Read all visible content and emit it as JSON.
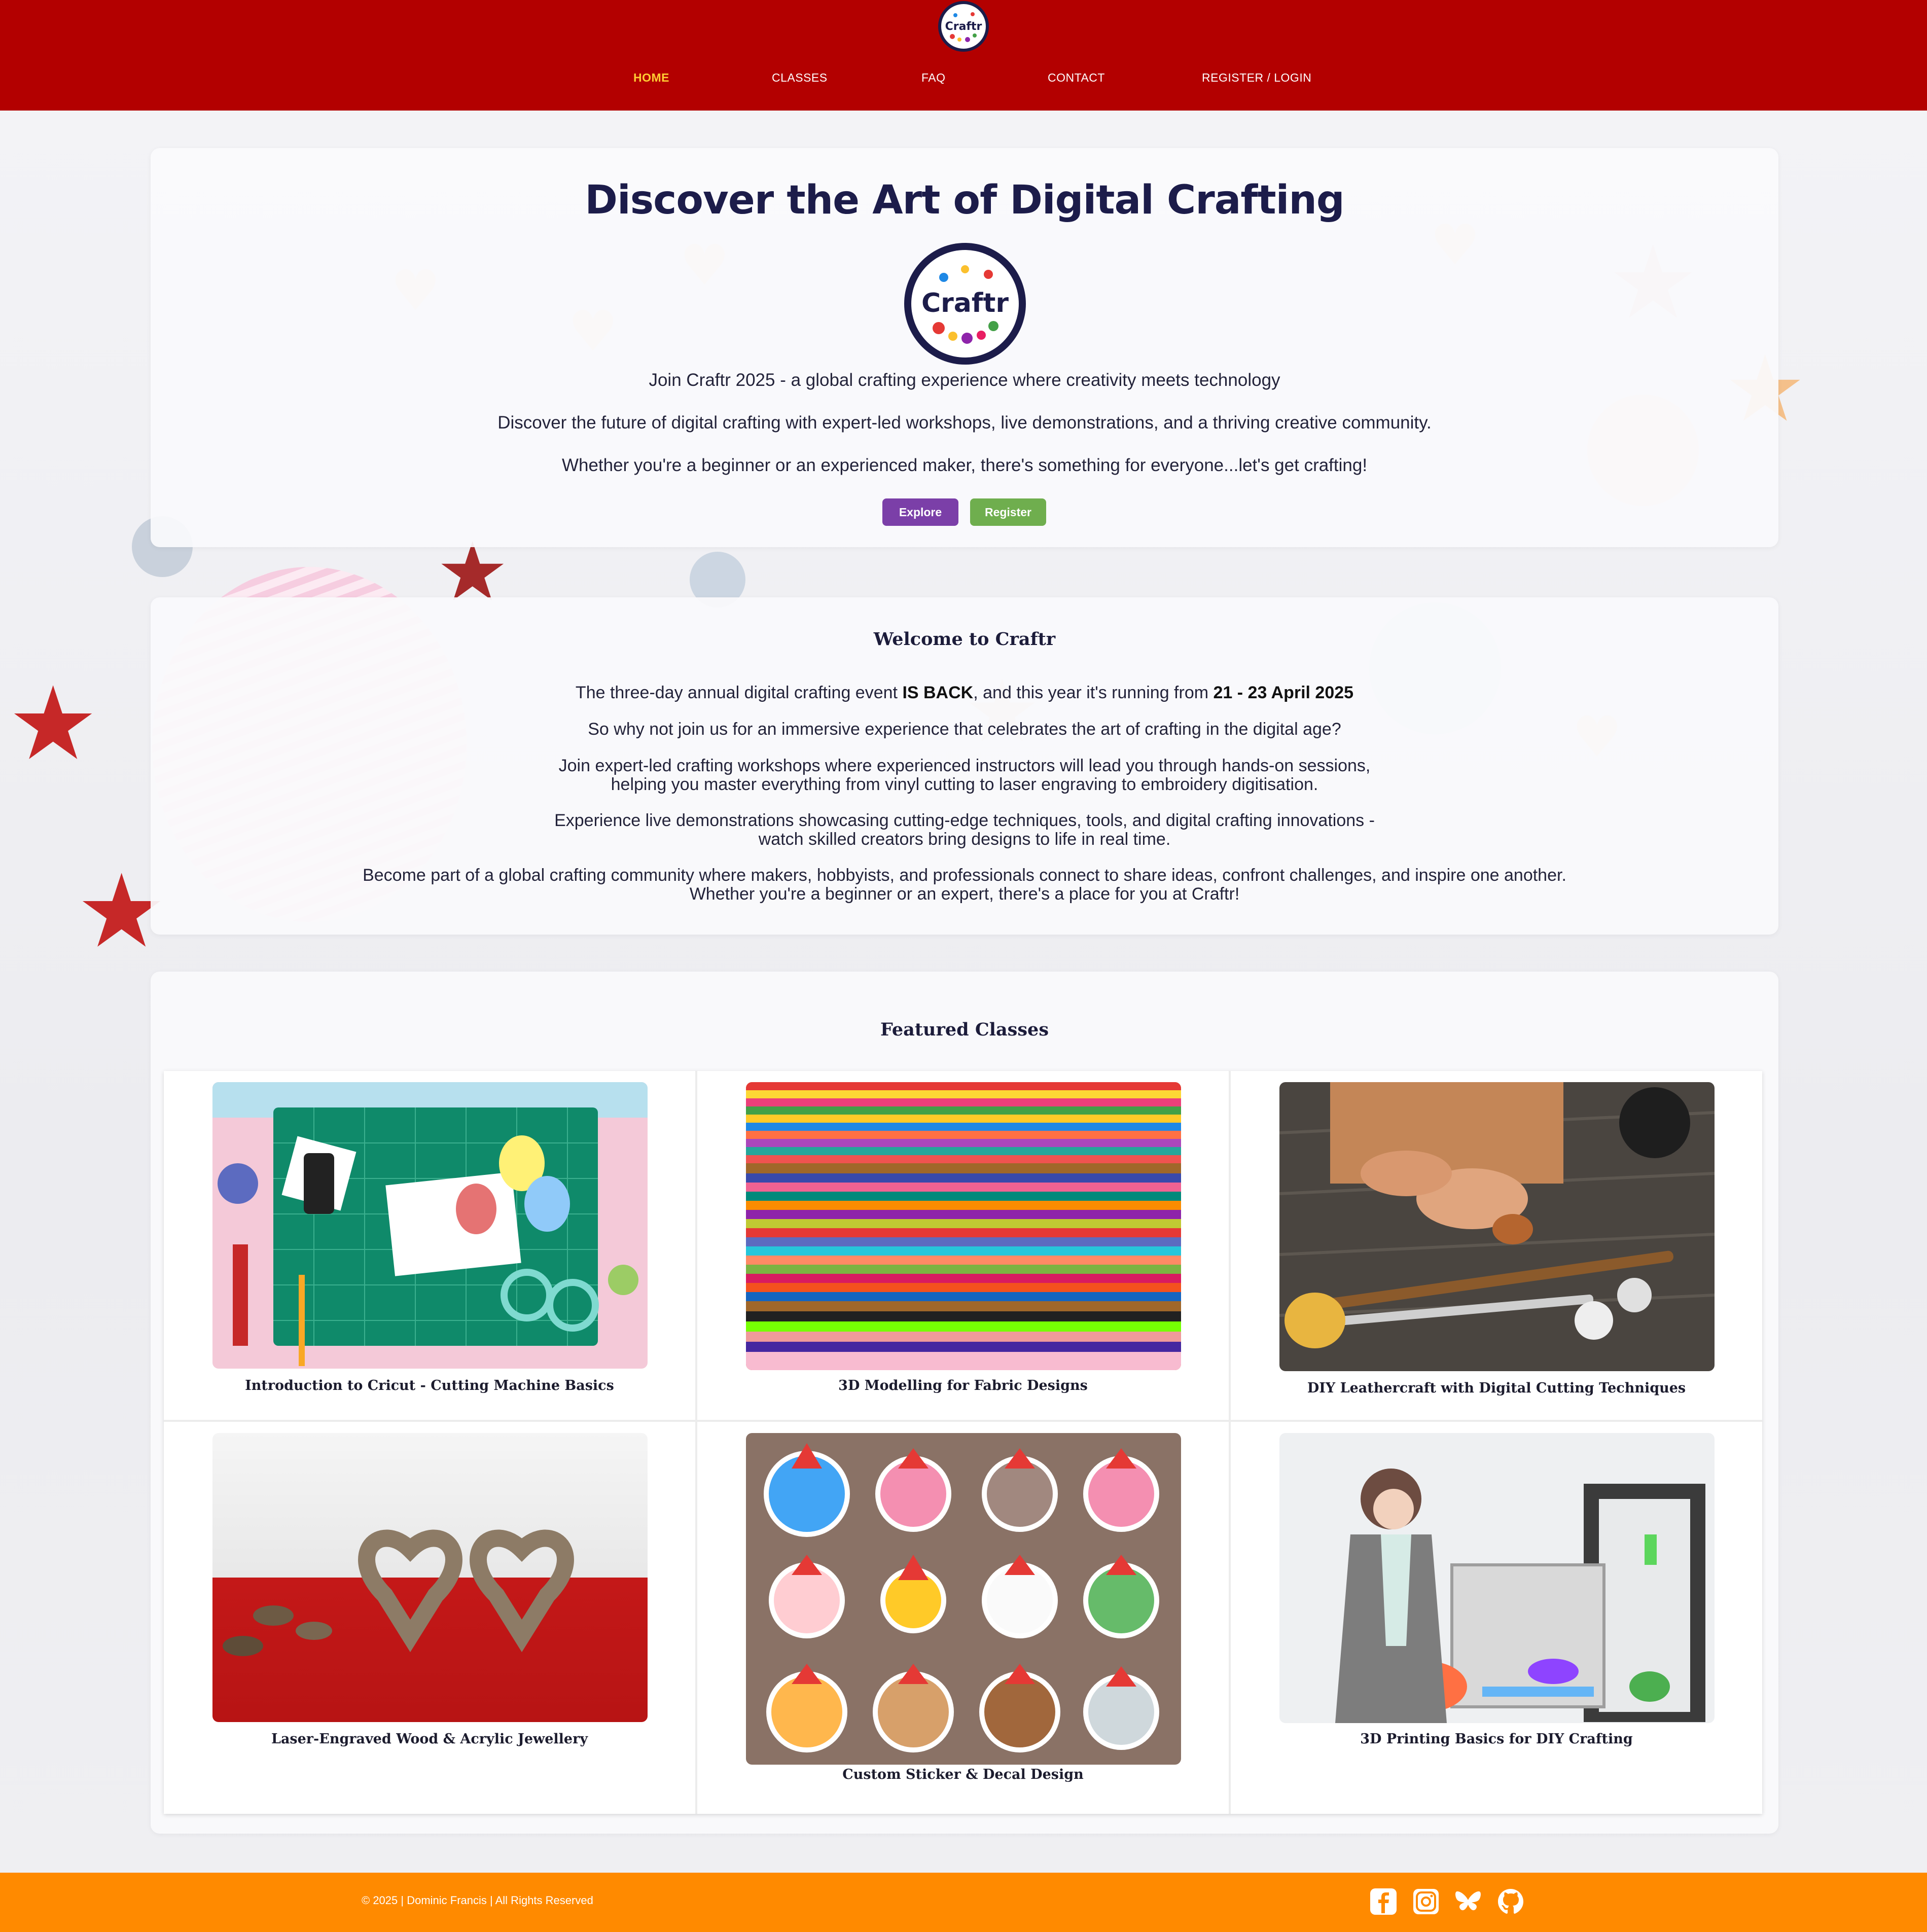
{
  "nav": {
    "logo_text": "Craftr",
    "items": [
      {
        "label": "HOME",
        "active": true
      },
      {
        "label": "CLASSES"
      },
      {
        "label": "FAQ"
      },
      {
        "label": "CONTACT"
      },
      {
        "label": "REGISTER / LOGIN"
      }
    ]
  },
  "hero": {
    "title": "Discover the Art of Digital Crafting",
    "logo_text": "Craftr",
    "lines": [
      "Join Craftr 2025 - a global crafting experience where creativity meets technology",
      "Discover the future of digital crafting with expert-led workshops, live demonstrations, and a thriving creative community.",
      "Whether you're a beginner or an experienced maker, there's something for everyone...let's get crafting!"
    ],
    "explore_label": "Explore",
    "register_label": "Register"
  },
  "welcome": {
    "title": "Welcome to Craftr",
    "p1_pre": "The three-day annual digital crafting event ",
    "p1_bold1": "IS BACK",
    "p1_mid": ", and this year it's running from ",
    "p1_bold2": "21 - 23 April 2025",
    "p2": "So why not join us for an immersive experience that celebrates the art of crafting in the digital age?",
    "p3a": "Join expert-led crafting workshops where experienced instructors will lead you through hands-on sessions,",
    "p3b": "helping you master everything from vinyl cutting to laser engraving to embroidery digitisation.",
    "p4a": "Experience live demonstrations showcasing cutting-edge techniques, tools, and digital crafting innovations -",
    "p4b": "watch skilled creators bring designs to life in real time.",
    "p5a": "Become part of a global crafting community where makers, hobbyists, and professionals connect to share ideas, confront challenges, and inspire one another.",
    "p5b": "Whether you're a beginner or an expert, there's a place for you at Craftr!"
  },
  "featured": {
    "title": "Featured Classes",
    "classes": [
      {
        "title": "Introduction to Cricut - Cutting Machine Basics"
      },
      {
        "title": "3D Modelling for Fabric Designs"
      },
      {
        "title": "DIY Leathercraft with Digital Cutting Techniques"
      },
      {
        "title": "Laser-Engraved Wood & Acrylic Jewellery"
      },
      {
        "title": "Custom Sticker & Decal Design"
      },
      {
        "title": "3D Printing Basics for DIY Crafting"
      }
    ]
  },
  "footer": {
    "copyright": "© 2025 | Dominic Francis | All Rights Reserved",
    "social": [
      "facebook-icon",
      "instagram-icon",
      "bluesky-icon",
      "github-icon"
    ]
  },
  "colors": {
    "header": "#b30000",
    "footer": "#ff8a00",
    "nav_active": "#ffcc33",
    "explore": "#7b3fa8",
    "register": "#6fae4e"
  }
}
